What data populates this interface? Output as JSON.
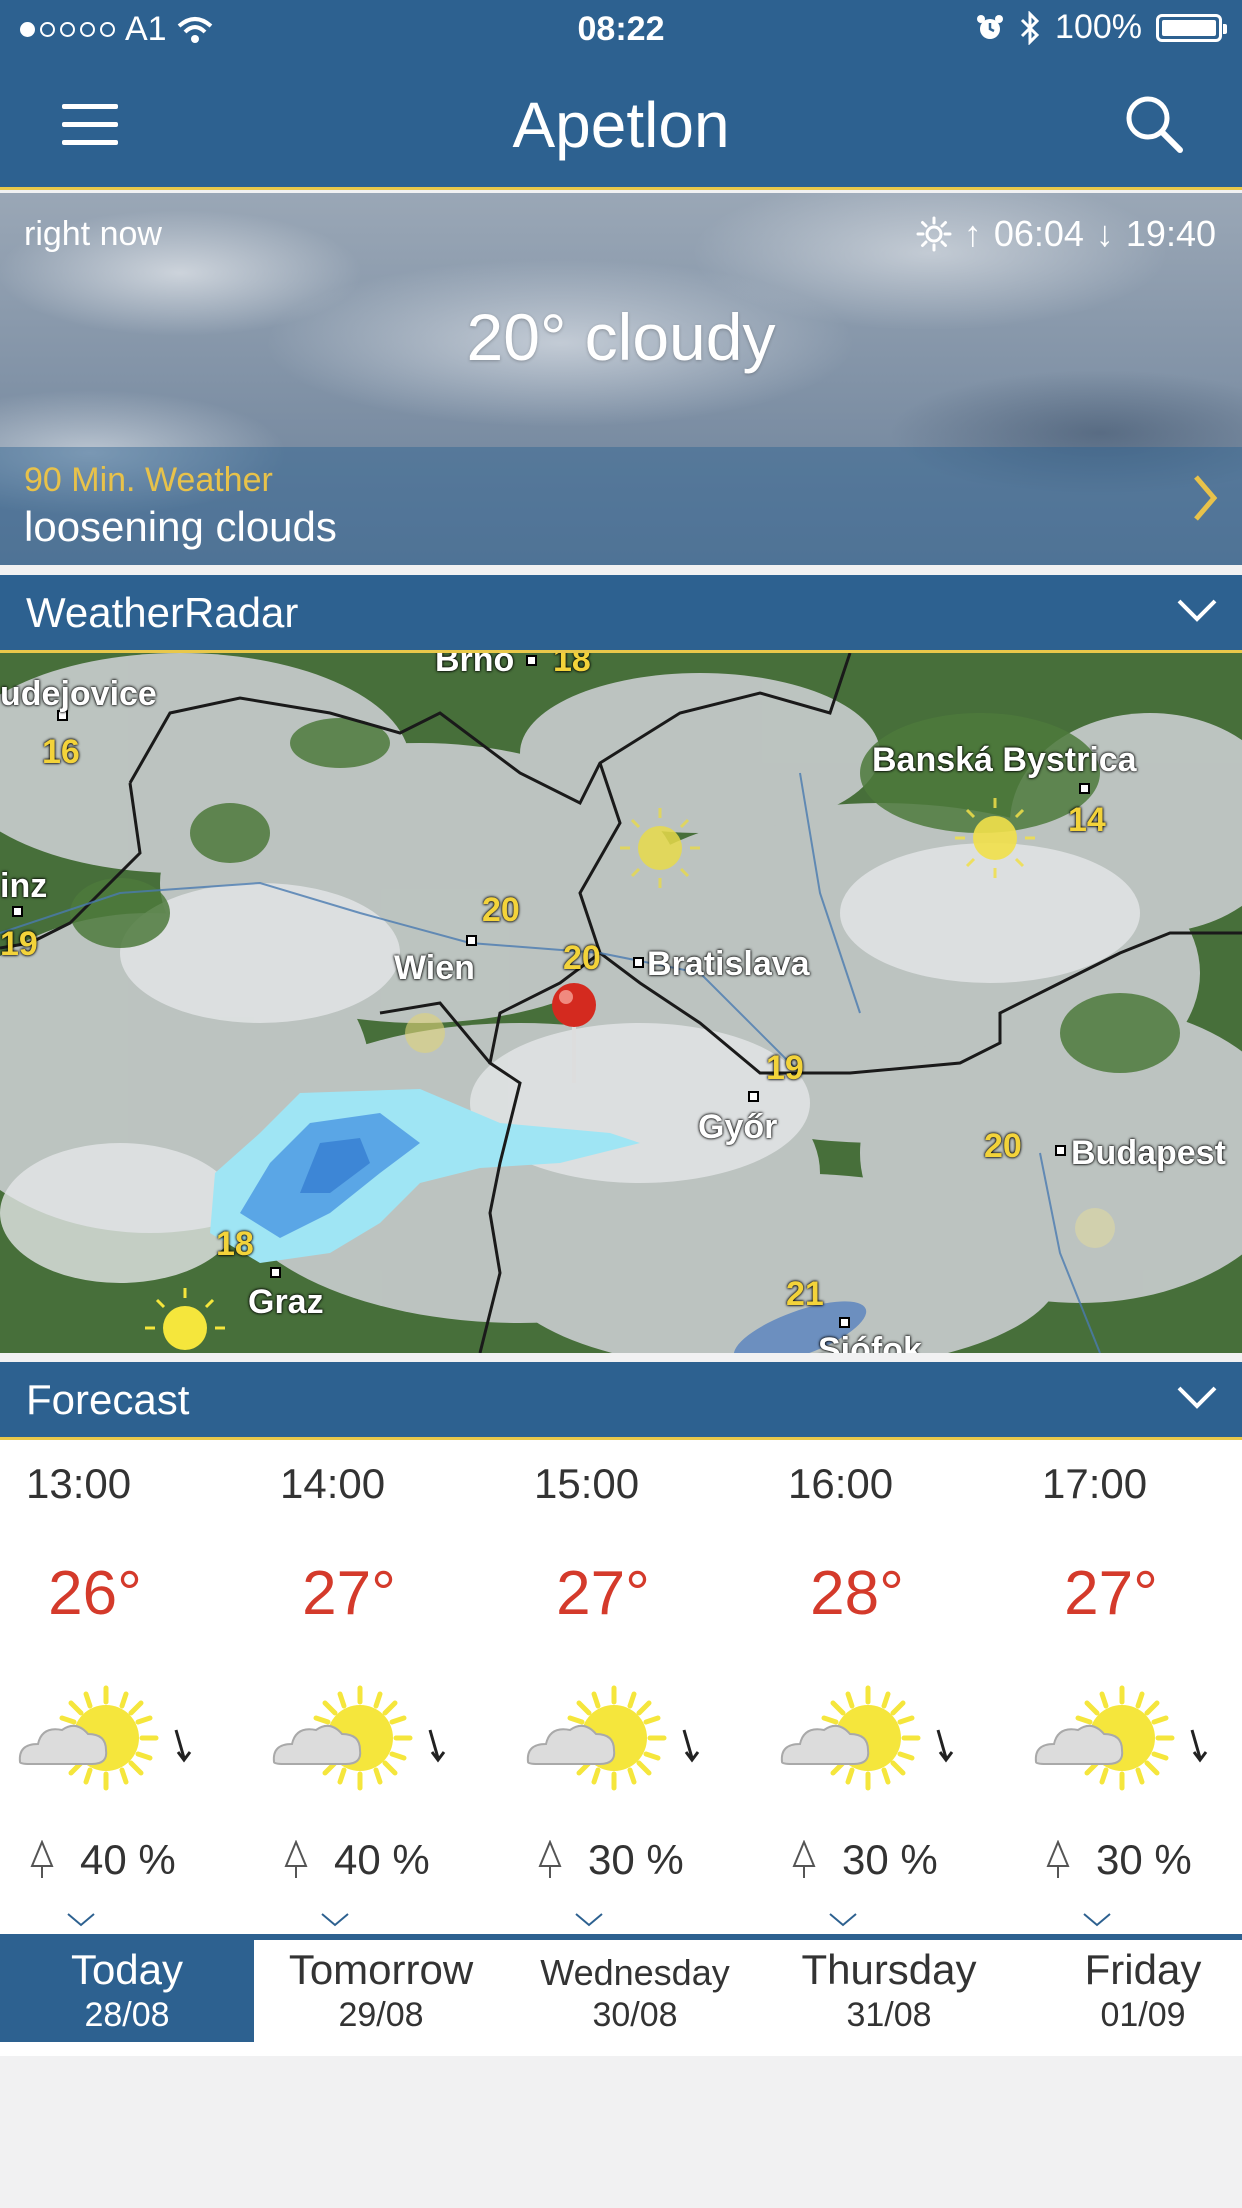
{
  "status_bar": {
    "carrier": "A1",
    "time": "08:22",
    "battery": "100%"
  },
  "header": {
    "title": "Apetlon",
    "menu_icon": "hamburger-menu-icon",
    "search_icon": "search-icon"
  },
  "current": {
    "label": "right now",
    "sunrise": "06:04",
    "sunset": "19:40",
    "condition": "20° cloudy",
    "nowcast_label": "90 Min. Weather",
    "nowcast_text": "loosening clouds"
  },
  "radar": {
    "section_title": "WeatherRadar",
    "cities": [
      "Brno",
      "udejovice",
      "Banská Bystrica",
      "inz",
      "Wien",
      "Bratislava",
      "Győr",
      "Budapest",
      "Graz",
      "Siófok"
    ],
    "temperatures": [
      "18",
      "16",
      "14",
      "19",
      "20",
      "20",
      "19",
      "20",
      "18",
      "21"
    ]
  },
  "forecast": {
    "section_title": "Forecast",
    "hours": [
      {
        "time": "13:00",
        "temp": "26°",
        "rain": "40 %"
      },
      {
        "time": "14:00",
        "temp": "27°",
        "rain": "40 %"
      },
      {
        "time": "15:00",
        "temp": "27°",
        "rain": "30 %"
      },
      {
        "time": "16:00",
        "temp": "28°",
        "rain": "30 %"
      },
      {
        "time": "17:00",
        "temp": "27°",
        "rain": "30 %"
      }
    ]
  },
  "days": [
    {
      "name": "Today",
      "date": "28/08"
    },
    {
      "name": "Tomorrow",
      "date": "29/08"
    },
    {
      "name": "Wednesday",
      "date": "30/08"
    },
    {
      "name": "Thursday",
      "date": "31/08"
    },
    {
      "name": "Friday",
      "date": "01/09"
    }
  ],
  "colors": {
    "primary": "#2d6190",
    "accent": "#e9c84a",
    "temperature": "#d43a2b"
  }
}
